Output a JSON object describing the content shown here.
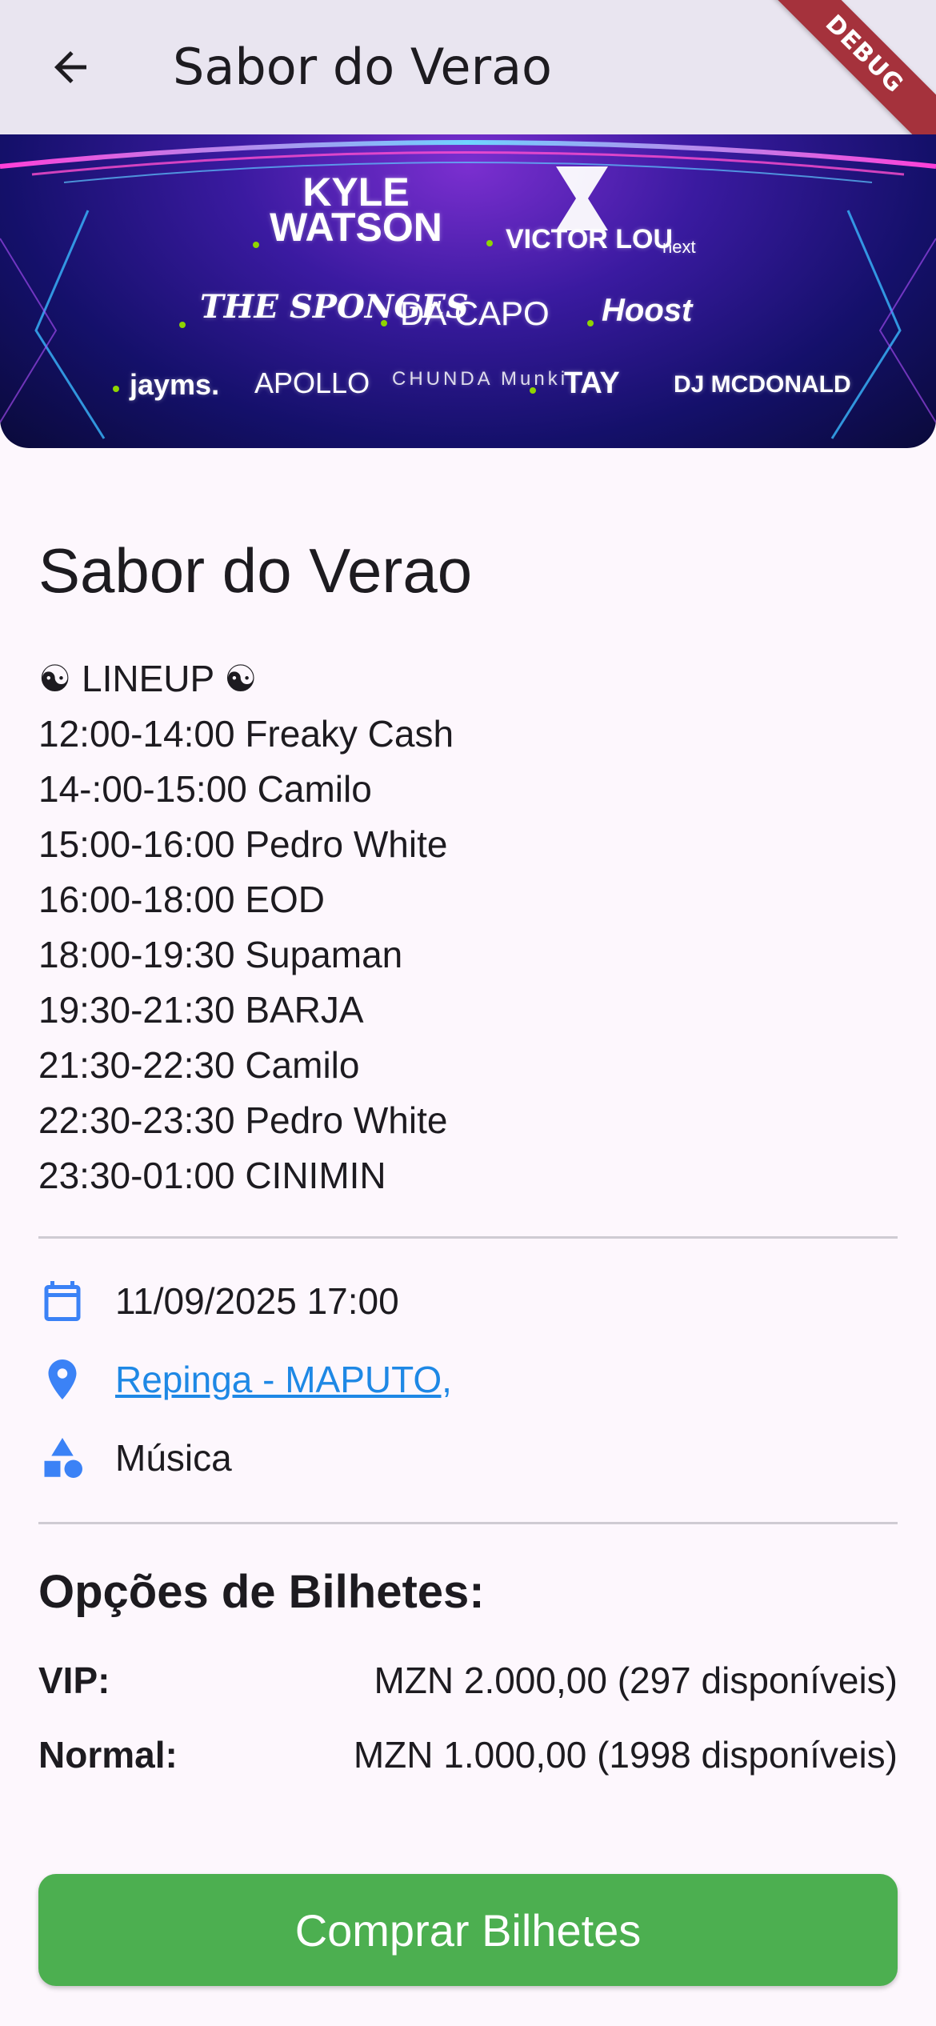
{
  "app_bar": {
    "title": "Sabor do Verao",
    "back_icon": "arrow-left-icon",
    "debug_label": "DEBUG"
  },
  "banner": {
    "artists": [
      "KYLE WATSON",
      "VICTOR LOU",
      "next",
      "THE SPONGES",
      "DA CAPO",
      "Hoost",
      "jayms.",
      "APOLLO",
      "CHUNDA Munki",
      "TAY",
      "DJ MCDONALD"
    ]
  },
  "event": {
    "title": "Sabor do Verao",
    "lineup": [
      "☯ LINEUP ☯",
      "12:00-14:00 Freaky Cash",
      "14-:00-15:00 Camilo",
      "15:00-16:00 Pedro White",
      "16:00-18:00 EOD",
      "18:00-19:30 Supaman",
      "19:30-21:30 BARJA",
      "21:30-22:30 Camilo",
      "22:30-23:30 Pedro White",
      "23:30-01:00 CINIMIN"
    ],
    "date": "11/09/2025 17:00",
    "date_icon": "calendar-icon",
    "location": "Repinga - MAPUTO,",
    "location_icon": "location-pin-icon",
    "category": "Música",
    "category_icon": "category-shapes-icon"
  },
  "tickets": {
    "heading": "Opções de Bilhetes:",
    "options": [
      {
        "name": "VIP:",
        "price": "MZN 2.000,00 (297 disponíveis)"
      },
      {
        "name": "Normal:",
        "price": "MZN 1.000,00 (1998 disponíveis)"
      }
    ]
  },
  "buy_button": {
    "label": "Comprar Bilhetes"
  },
  "colors": {
    "accent": "#3b82f6",
    "link": "#1e88e5",
    "buy_button": "#4caf50",
    "app_bar": "#e9e5f0",
    "background": "#fdf7fd"
  }
}
